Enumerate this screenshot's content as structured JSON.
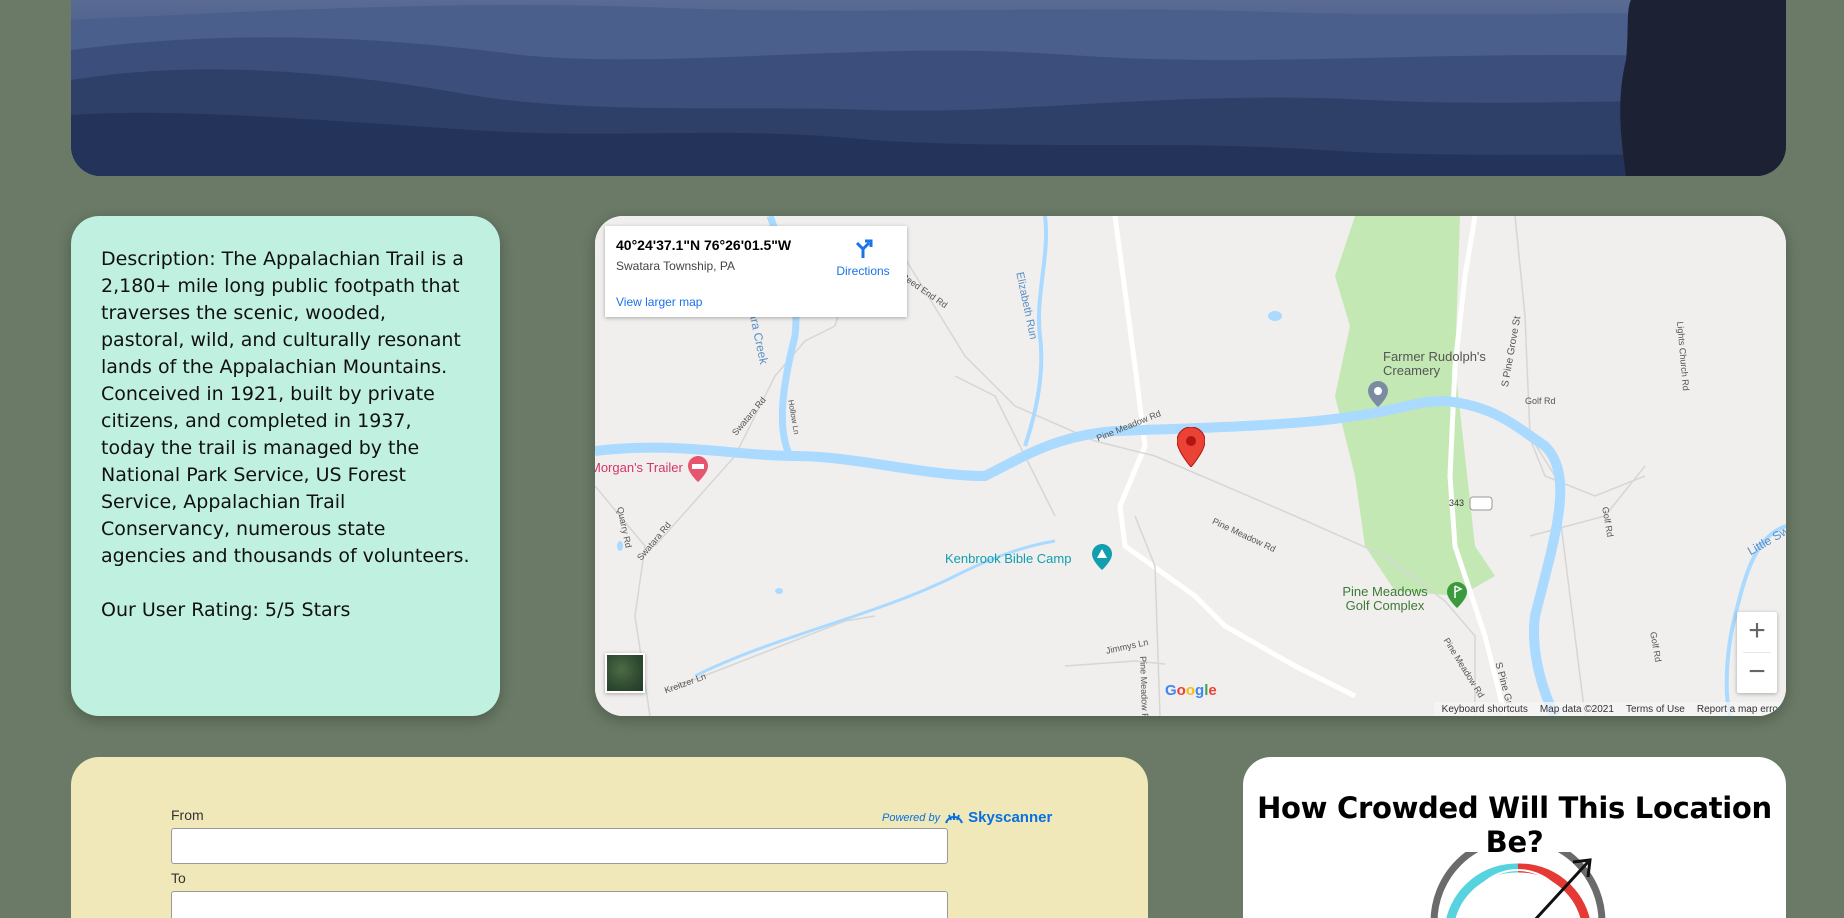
{
  "description_card": {
    "description": "Description: The Appalachian Trail is a 2,180+ mile long public footpath that traverses the scenic, wooded, pastoral, wild, and culturally resonant lands of the Appalachian Mountains. Conceived in 1921, built by private citizens, and completed in 1937, today the trail is managed by the National Park Service, US Forest Service, Appalachian Trail Conservancy, numerous state agencies and thousands of volunteers.",
    "rating": "Our User Rating: 5/5 Stars"
  },
  "map": {
    "info": {
      "coords": "40°24'37.1\"N 76°26'01.5\"W",
      "place": "Swatara Township, PA",
      "larger_map_link": "View larger map",
      "directions_label": "Directions"
    },
    "labels": {
      "farmer": "Farmer Rudolph's Creamery",
      "morgans": "Morgan's Trailer",
      "kenbrook": "Kenbrook Bible Camp",
      "pine_meadows_golf": "Pine Meadows Golf Complex",
      "route_343": "343",
      "s_pine_grove": "S Pine Grove St",
      "s_pine_gr": "S Pine Gr",
      "pine_meadow_rd_1": "Pine Meadow Rd",
      "pine_meadow_rd_2": "Pine Meadow Rd",
      "pine_meadow_rd_3": "Pine Meadow Rd",
      "pine_meadow_rd_4": "Pine Meadow R",
      "elizabeth_run": "Elizabeth Run",
      "swatara_creek": "ara Creek",
      "swatara_rd_1": "Swatara Rd",
      "swatara_rd_2": "Swatara Rd",
      "quarry_rd": "Quarry Rd",
      "golf_rd_1": "Golf Rd",
      "golf_rd_2": "Golf Rd",
      "golf_rd_3": "Golf Rd",
      "lights_church": "Lights Church Rd",
      "little_sw": "Little Sw",
      "jimmys_ln": "Jimmys Ln",
      "kreitzer_ln": "Kreitzer Ln",
      "reed_end_rd": "Reed End Rd",
      "rd_fragment": "Rd",
      "hollow_ln": "Hollow Ln"
    },
    "zoom_in": "+",
    "zoom_out": "−",
    "google_logo": "Google",
    "footer": {
      "shortcuts": "Keyboard shortcuts",
      "data": "Map data ©2021",
      "terms": "Terms of Use",
      "report": "Report a map erro"
    },
    "icons": {
      "marker": "red-location-pin",
      "lodging": "bed-icon",
      "camp": "camp-icon",
      "golf": "golf-icon",
      "store": "pin-icon"
    }
  },
  "flight_form": {
    "from_label": "From",
    "to_label": "To",
    "from_value": "",
    "to_value": "",
    "powered_by": "Powered by",
    "brand": "Skyscanner"
  },
  "crowd": {
    "title": "How Crowded Will This Location Be?"
  },
  "colors": {
    "page_bg": "#6a7a66",
    "description_bg": "#c0f0e0",
    "flight_bg": "#f0e8b8",
    "water": "#aadaff",
    "park": "#c4e8b4",
    "marker": "#ea4335"
  }
}
